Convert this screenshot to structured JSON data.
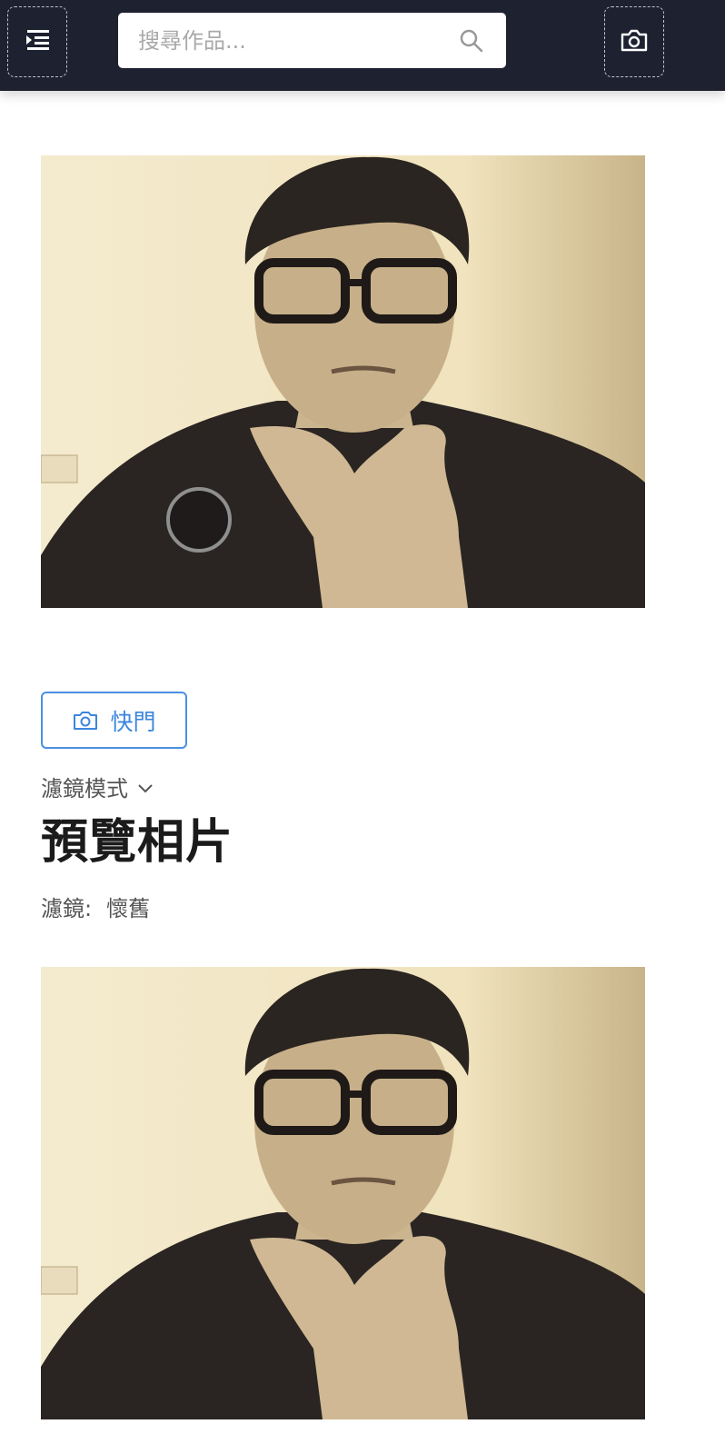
{
  "header": {
    "search_placeholder": "搜尋作品...",
    "menu_icon": "menu-indent-icon",
    "search_icon": "search-icon",
    "camera_icon": "camera-icon"
  },
  "camera_view": {
    "image_description": "",
    "shutter_overlay_icon": "circle-shutter-icon"
  },
  "controls": {
    "shutter_label": "快門",
    "shutter_icon": "camera-icon",
    "mode_label": "濾鏡模式",
    "mode_icon": "chevron-down-icon"
  },
  "preview": {
    "title": "預覽相片",
    "filter_label": "濾鏡:",
    "filter_value": "懷舊"
  },
  "colors": {
    "header_bg": "#1d2130",
    "accent": "#4a90e2",
    "sepia_bg": "#efe3c0"
  }
}
